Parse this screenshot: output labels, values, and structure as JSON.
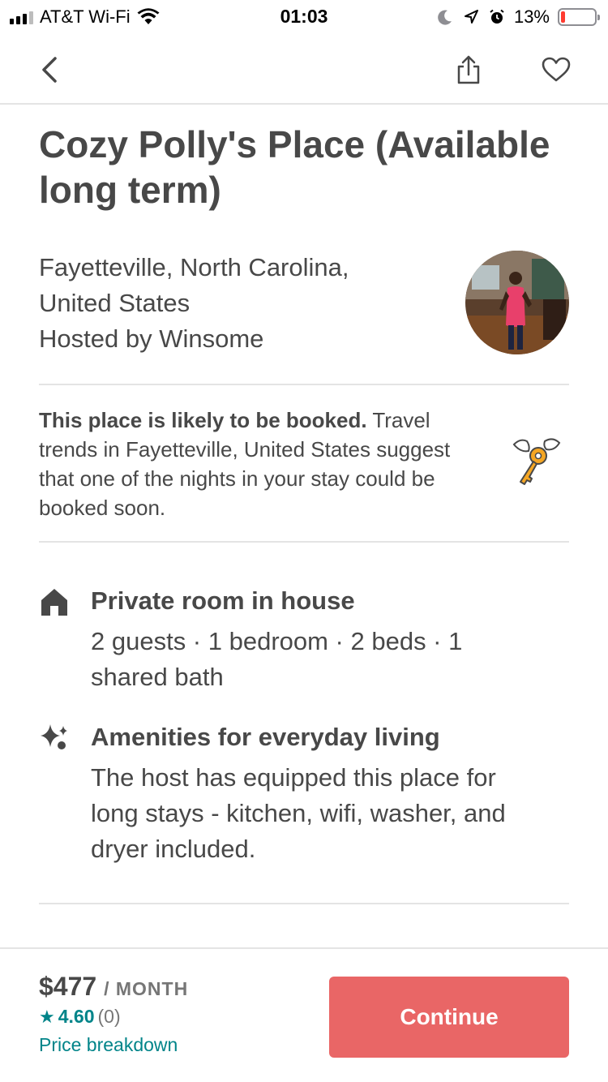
{
  "status_bar": {
    "carrier": "AT&T Wi-Fi",
    "time": "01:03",
    "battery": "13%",
    "battery_level": 0.13
  },
  "nav": {
    "back_icon": "chevron-left-icon",
    "share_icon": "share-icon",
    "favorite_icon": "heart-icon"
  },
  "listing": {
    "title": "Cozy Polly's Place (Available long term)",
    "location": "Fayetteville, North Carolina, United States",
    "host": "Hosted by Winsome"
  },
  "notice": {
    "bold": "This place is likely to be booked.",
    "text": " Travel trends in Fayetteville, United States suggest that one of the nights in your stay could be booked soon."
  },
  "features": [
    {
      "icon": "house-icon",
      "title": "Private room in house",
      "description": "2 guests · 1 bedroom · 2 beds · 1 shared bath"
    },
    {
      "icon": "sparkle-icon",
      "title": "Amenities for everyday living",
      "description": "The host has equipped this place for long stays - kitchen, wifi, washer, and dryer included."
    }
  ],
  "booking": {
    "price": "$477",
    "per": "/ MONTH",
    "rating": "4.60",
    "reviews": "(0)",
    "breakdown": "Price breakdown",
    "continue": "Continue"
  },
  "colors": {
    "primary_button": "#e96666",
    "link": "#008489",
    "text": "#484848"
  }
}
